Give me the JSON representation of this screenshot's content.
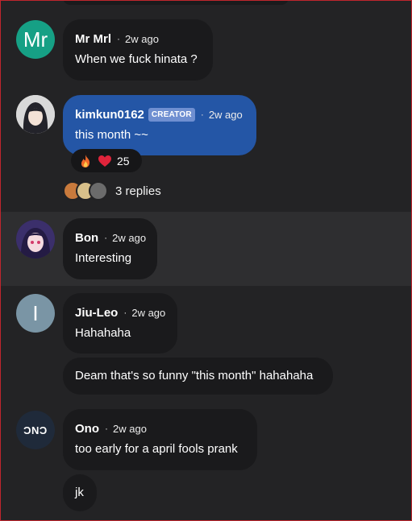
{
  "comments": [
    {
      "avatar_text": "Mr",
      "avatar_color": "#16a085",
      "name": "Mr Mrl",
      "time": "2w ago",
      "text": "When we fuck hinata ?"
    },
    {
      "name": "kimkun0162",
      "badge": "CREATOR",
      "time": "2w ago",
      "text": "this month ~~",
      "reactions": {
        "count": "25",
        "icons": [
          "fire-icon",
          "heart-icon"
        ]
      },
      "replies": "3 replies"
    },
    {
      "name": "Bon",
      "time": "2w ago",
      "text": "Interesting"
    },
    {
      "avatar_text": "I",
      "avatar_color": "#7a95a5",
      "name": "Jiu-Leo",
      "time": "2w ago",
      "text": "Hahahaha",
      "followup": "Deam that's so funny \"this month\" hahahaha"
    },
    {
      "avatar_text": "ƆNƆ",
      "avatar_color": "#1f2a3a",
      "name": "Ono",
      "time": "2w ago",
      "text": "too early for a april fools prank",
      "followup": "jk"
    }
  ],
  "colors": {
    "creator_bubble": "#2456a6",
    "bubble": "#1a1a1c",
    "background": "#232325",
    "highlight": "#2e2e30"
  }
}
